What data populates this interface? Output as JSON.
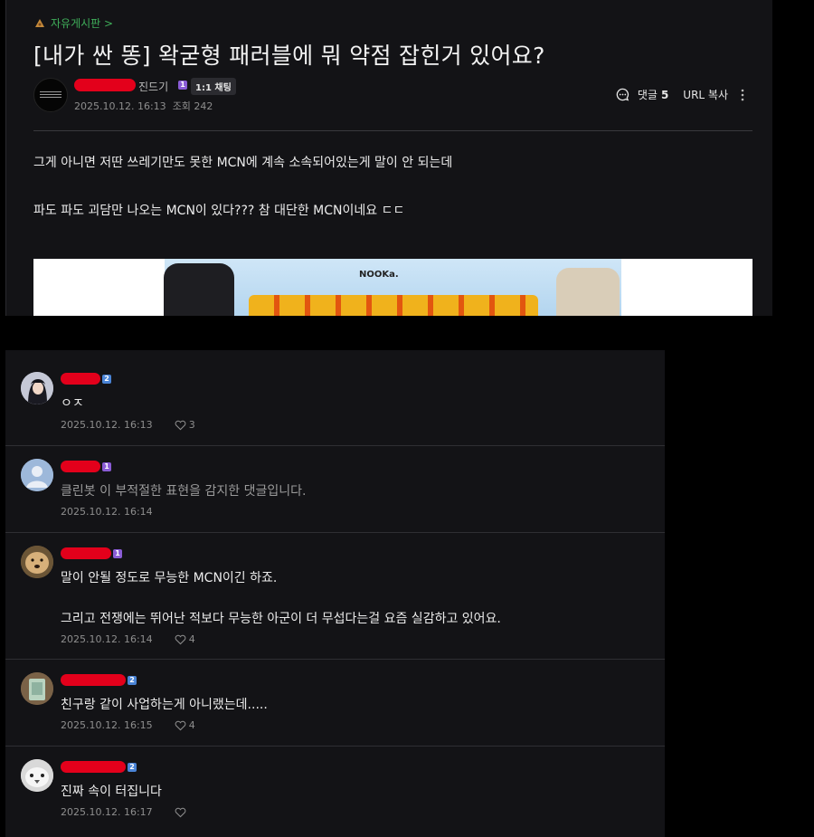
{
  "article": {
    "board": "자유게시판 >",
    "title": "[내가 싼 똥] 왁굳형 패러블에 뭐 약점 잡힌거 있어요?",
    "author_nick": "진드기",
    "author_level": "1",
    "chat_label": "1:1 채팅",
    "date": "2025.10.12. 16:13",
    "views_label": "조회 242",
    "comment_label": "댓글",
    "comment_count": "5",
    "url_copy": "URL 복사",
    "body": [
      "그게 아니면 저딴 쓰레기만도 못한 MCN에 계속 소속되어있는게 말이 안 되는데",
      "파도 파도 괴담만 나오는 MCN이 있다??? 참 대단한 MCN이네요 ㄷㄷ"
    ],
    "banner_brand": "NOOKa."
  },
  "comments": [
    {
      "level": "2",
      "level_color": "blue",
      "text": [
        "ㅇㅈ"
      ],
      "date": "2025.10.12. 16:13",
      "likes": "3",
      "blocked": false,
      "avatar": "anime-girl"
    },
    {
      "level": "1",
      "level_color": "purple",
      "text": [
        "클린봇 이 부적절한 표현을 감지한 댓글입니다."
      ],
      "date": "2025.10.12. 16:14",
      "likes": "",
      "blocked": true,
      "avatar": "default-person"
    },
    {
      "level": "1",
      "level_color": "purple",
      "text": [
        "말이 안될 정도로 무능한 MCN이긴 하죠.",
        "그리고 전쟁에는 뛰어난 적보다 무능한 아군이 더 무섭다는걸 요즘 실감하고 있어요."
      ],
      "date": "2025.10.12. 16:14",
      "likes": "4",
      "blocked": false,
      "avatar": "dog"
    },
    {
      "level": "2",
      "level_color": "blue",
      "text": [
        "친구랑 같이 사업하는게 아니랬는데....."
      ],
      "date": "2025.10.12. 16:15",
      "likes": "4",
      "blocked": false,
      "avatar": "photo"
    },
    {
      "level": "2",
      "level_color": "blue",
      "text": [
        "진짜 속이 터집니다"
      ],
      "date": "2025.10.12. 16:17",
      "likes": "",
      "blocked": false,
      "avatar": "bird"
    }
  ],
  "colors": {
    "board_green": "#3fae5a",
    "redaction": "#e3001b",
    "level_purple": "#8a5cd6",
    "level_blue": "#4a84d6"
  }
}
